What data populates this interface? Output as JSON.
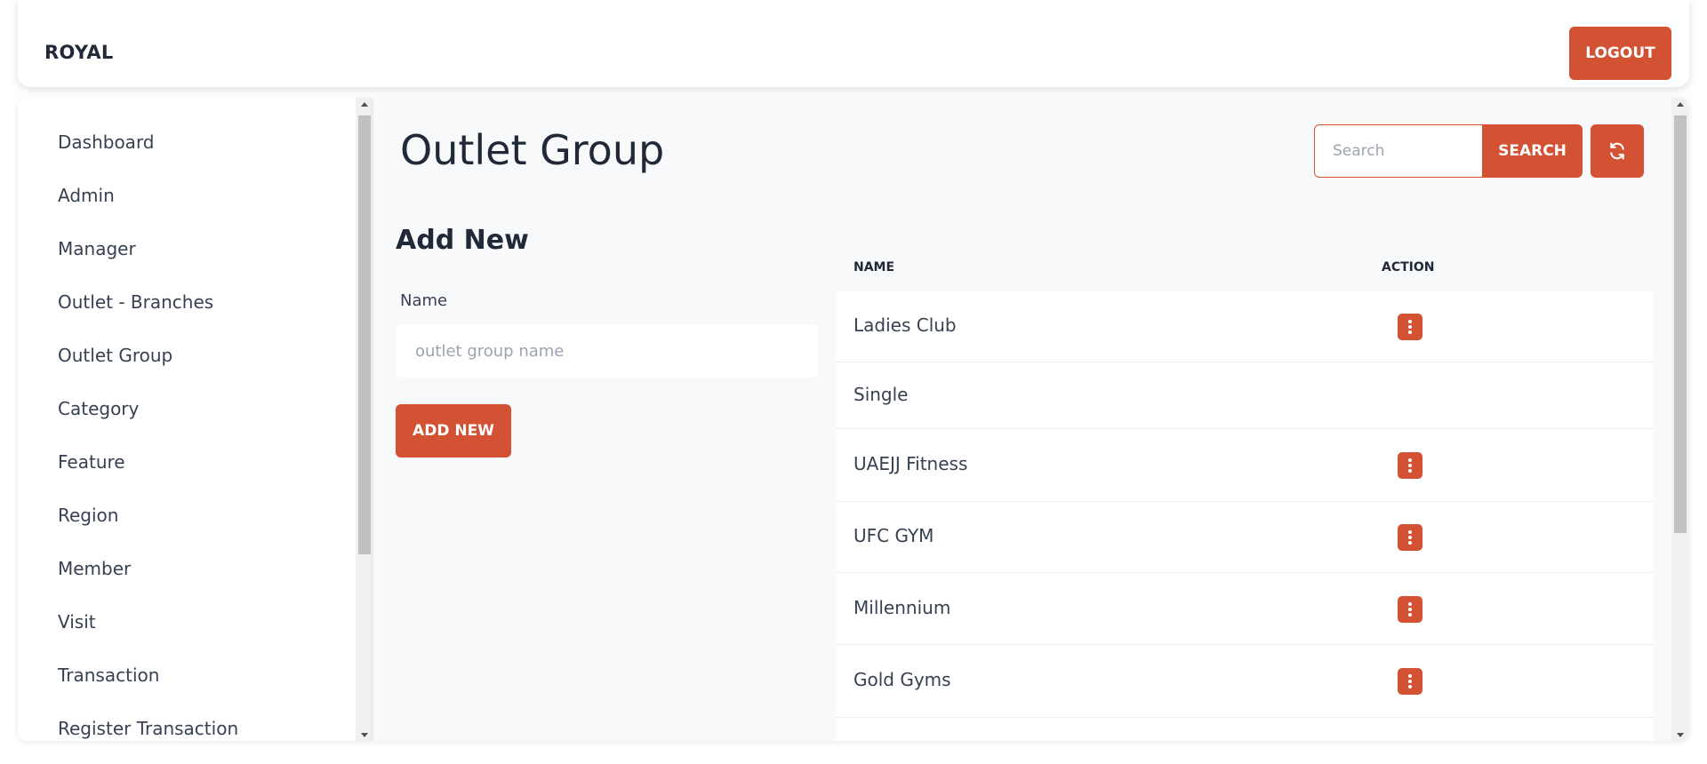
{
  "header": {
    "brand": "ROYAL",
    "logout_label": "LOGOUT"
  },
  "sidebar": {
    "items": [
      {
        "label": "Dashboard"
      },
      {
        "label": "Admin"
      },
      {
        "label": "Manager"
      },
      {
        "label": "Outlet - Branches"
      },
      {
        "label": "Outlet Group"
      },
      {
        "label": "Category"
      },
      {
        "label": "Feature"
      },
      {
        "label": "Region"
      },
      {
        "label": "Member"
      },
      {
        "label": "Visit"
      },
      {
        "label": "Transaction"
      },
      {
        "label": "Register Transaction"
      }
    ]
  },
  "main": {
    "title": "Outlet Group",
    "search": {
      "placeholder": "Search",
      "button_label": "SEARCH"
    },
    "refresh_icon": "refresh-icon",
    "form": {
      "title": "Add New",
      "name_label": "Name",
      "name_placeholder": "outlet group name",
      "submit_label": "ADD NEW"
    },
    "table": {
      "columns": [
        "NAME",
        "ACTION"
      ],
      "rows": [
        {
          "name": "Ladies Club",
          "has_action": true
        },
        {
          "name": "Single",
          "has_action": false
        },
        {
          "name": "UAEJJ Fitness",
          "has_action": true
        },
        {
          "name": "UFC GYM",
          "has_action": true
        },
        {
          "name": "Millennium",
          "has_action": true
        },
        {
          "name": "Gold Gyms",
          "has_action": true
        }
      ]
    }
  },
  "colors": {
    "accent": "#d35233",
    "text": "#1f2937",
    "panel": "#f8f9fb"
  }
}
